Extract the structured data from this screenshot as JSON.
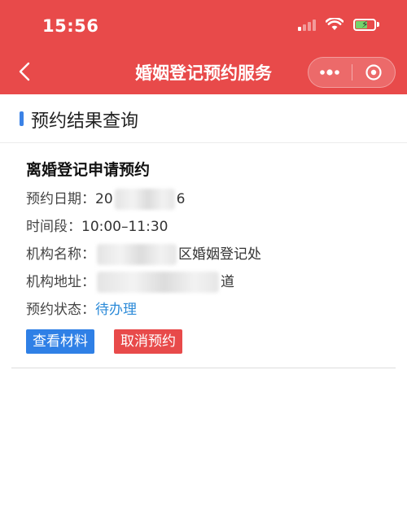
{
  "status_bar": {
    "time": "15:56"
  },
  "nav": {
    "title": "婚姻登记预约服务"
  },
  "section": {
    "title": "预约结果查询"
  },
  "card": {
    "title": "离婚登记申请预约",
    "date": {
      "label": "预约日期：",
      "value_prefix": "20",
      "value_suffix": "6"
    },
    "time_slot": {
      "label": "时间段：",
      "value": "10:00–11:30"
    },
    "org_name": {
      "label": "机构名称：",
      "value_suffix": "区婚姻登记处"
    },
    "org_address": {
      "label": "机构地址：",
      "value_suffix": "道"
    },
    "state": {
      "label": "预约状态：",
      "value": "待办理"
    },
    "view_materials_label": "查看材料",
    "cancel_label": "取消预约"
  },
  "colors": {
    "header_red": "#e84a4a",
    "accent_blue": "#2f80e6",
    "status_blue": "#2b8ad8"
  }
}
